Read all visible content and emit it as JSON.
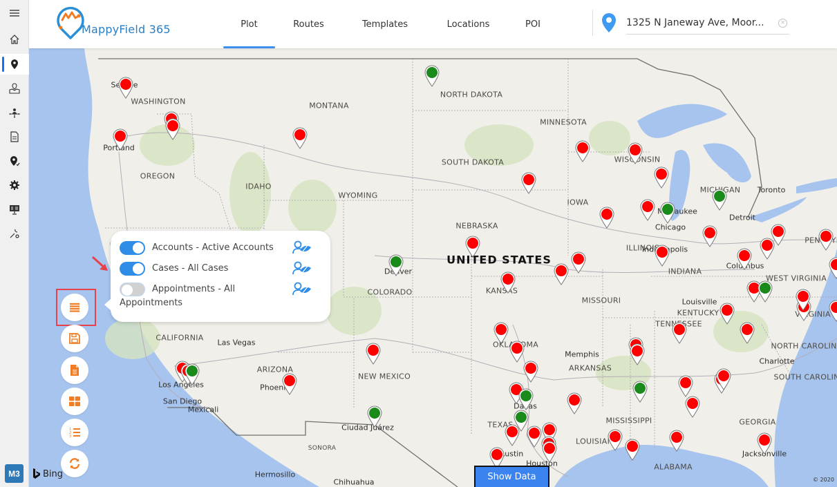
{
  "app": {
    "logo_text": "MappyField 365",
    "user_initials": "M3",
    "accent_color": "#3d8ff0",
    "brand_orange": "#f07c24"
  },
  "sidebar": {
    "items": [
      {
        "name": "menu",
        "icon": "hamburger-icon"
      },
      {
        "name": "home",
        "icon": "home-icon"
      },
      {
        "name": "plot",
        "icon": "map-pin-icon",
        "active": true
      },
      {
        "name": "map-area",
        "icon": "map-location-icon"
      },
      {
        "name": "territory",
        "icon": "network-person-icon"
      },
      {
        "name": "document",
        "icon": "document-icon"
      },
      {
        "name": "check-in",
        "icon": "pin-check-icon"
      },
      {
        "name": "settings",
        "icon": "gear-icon"
      },
      {
        "name": "presentation",
        "icon": "presentation-icon"
      },
      {
        "name": "tools",
        "icon": "wrench-gear-icon"
      }
    ]
  },
  "header": {
    "tabs": [
      {
        "label": "Plot",
        "active": true
      },
      {
        "label": "Routes",
        "active": false
      },
      {
        "label": "Templates",
        "active": false
      },
      {
        "label": "Locations",
        "active": false
      },
      {
        "label": "POI",
        "active": false
      }
    ],
    "address": {
      "value": "1325 N Janeway Ave, Moor...",
      "icon": "location-pin-icon"
    }
  },
  "layers_popup": {
    "layers": [
      {
        "label": "Accounts - Active Accounts",
        "enabled": true
      },
      {
        "label": "Cases - All Cases",
        "enabled": true
      },
      {
        "label": "Appointments - All",
        "label_wrap": "Appointments",
        "enabled": false
      }
    ]
  },
  "fab_buttons": [
    {
      "name": "layers",
      "icon": "layers-list-icon"
    },
    {
      "name": "save",
      "icon": "floppy-disk-icon"
    },
    {
      "name": "file",
      "icon": "file-icon"
    },
    {
      "name": "grid",
      "icon": "grid-icon"
    },
    {
      "name": "numbered-list",
      "icon": "numbered-list-icon"
    },
    {
      "name": "refresh",
      "icon": "refresh-icon"
    }
  ],
  "map": {
    "provider": "Bing",
    "copyright": "© 2020",
    "show_data_label": "Show Data",
    "marker_colors": {
      "account": "#ff0000",
      "case": "#1a8a1a"
    },
    "country_label": "UNITED STATES",
    "state_labels": [
      "WASHINGTON",
      "MONTANA",
      "NORTH DAKOTA",
      "MINNESOTA",
      "SOUTH DAKOTA",
      "WISCONSIN",
      "OREGON",
      "IDAHO",
      "WYOMING",
      "IOWA",
      "MICHIGAN",
      "NEBRASKA",
      "ILLINOIS",
      "INDIANA",
      "PENNSYLVANIA",
      "COLORADO",
      "KANSAS",
      "MISSOURI",
      "KENTUCKY",
      "WEST VIRGINIA",
      "VIRGINIA",
      "CALIFORNIA",
      "TENNESSEE",
      "NORTH CAROLINA",
      "OKLAHOMA",
      "ARIZONA",
      "NEW MEXICO",
      "ARKANSAS",
      "SOUTH CAROLINA",
      "ALABAMA",
      "GEORGIA",
      "TEXAS",
      "MISSISSIPPI",
      "LOUISIANA",
      "SONORA"
    ],
    "city_labels": [
      "Seattle",
      "Portland",
      "Denver",
      "Chicago",
      "Detroit",
      "Toronto",
      "Milwaukee",
      "Indianapolis",
      "Columbus",
      "Louisville",
      "Memphis",
      "Charlotte",
      "Las Vegas",
      "Los Angeles",
      "San Diego",
      "Mexicali",
      "Phoenix",
      "Ciudad Juárez",
      "Hermosillo",
      "Chihuahua",
      "Austin",
      "Houston",
      "Jacksonville",
      "Dallas"
    ]
  }
}
